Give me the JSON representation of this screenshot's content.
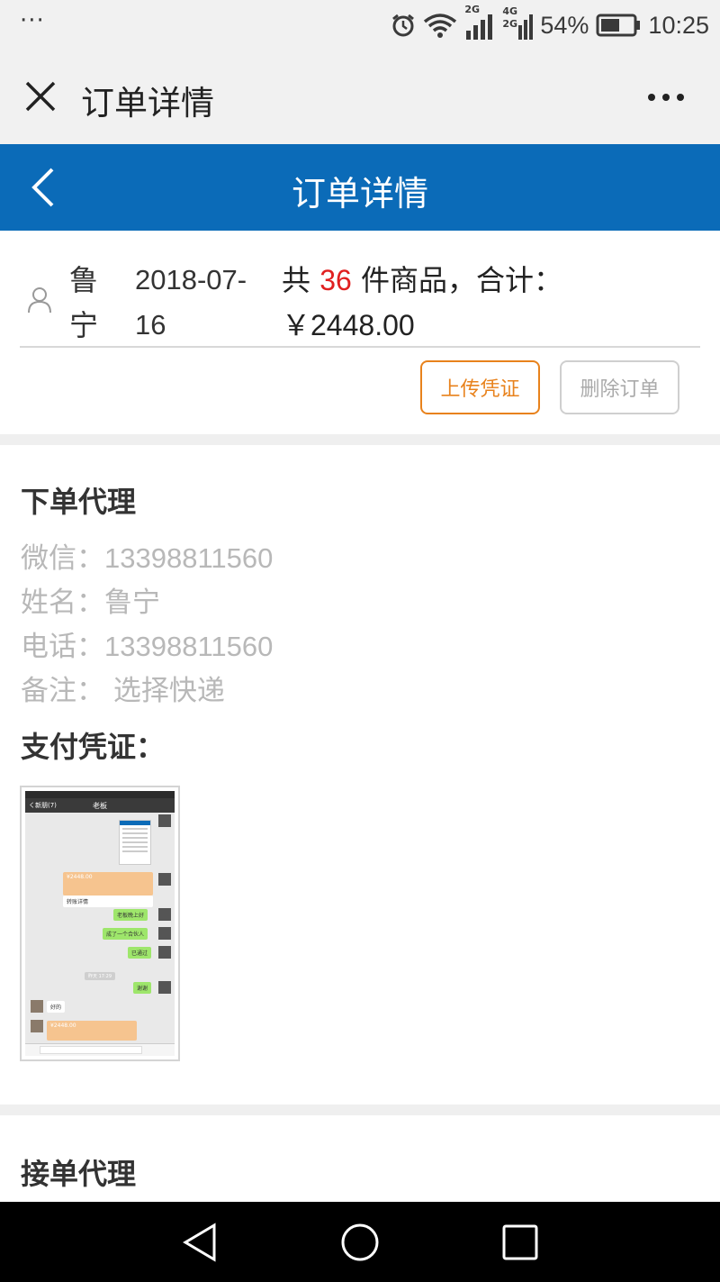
{
  "status_bar": {
    "battery": "54%",
    "time": "10:25",
    "net1": "2G",
    "net2a": "4G",
    "net2b": "2G"
  },
  "wechat": {
    "title": "订单详情"
  },
  "header": {
    "title": "订单详情"
  },
  "order": {
    "buyer_name_line1": "鲁",
    "buyer_name_line2": "宁",
    "date_line1": "2018-07-",
    "date_line2": "16",
    "total_prefix": "共",
    "item_count": "36",
    "total_suffix": "件商品，合计：",
    "amount": "￥2448.00",
    "upload_button": "上传凭证",
    "delete_button": "删除订单"
  },
  "ordering_agent": {
    "title": "下单代理",
    "wechat_label": "微信：",
    "wechat_value": "13398811560",
    "name_label": "姓名：",
    "name_value": "鲁宁",
    "phone_label": "电话：",
    "phone_value": "13398811560",
    "note_label": "备注：",
    "note_value": "选择快递",
    "payment_title": "支付凭证：",
    "receipt": {
      "nav_back": "く新朋(7)",
      "nav_title": "老板",
      "amount1": "¥2448.00",
      "msg_label": "转账详情",
      "msg1": "老板晚上好",
      "msg2": "成了一个合伙人",
      "msg3": "已通过",
      "time_label": "昨天 17:29",
      "msg4": "谢谢",
      "msg5": "好的",
      "amount2": "¥2448.00"
    }
  },
  "receiving_agent": {
    "title": "接单代理"
  },
  "colors": {
    "header_blue": "#0b6bb8",
    "accent_orange": "#e8821c",
    "highlight_red": "#e02020",
    "muted_gray": "#b8b8b8"
  },
  "icons": [
    "alarm-icon",
    "wifi-icon",
    "signal-icon",
    "battery-icon",
    "close-icon",
    "more-icon",
    "back-icon",
    "user-icon",
    "nav-back-icon",
    "nav-home-icon",
    "nav-recent-icon"
  ]
}
